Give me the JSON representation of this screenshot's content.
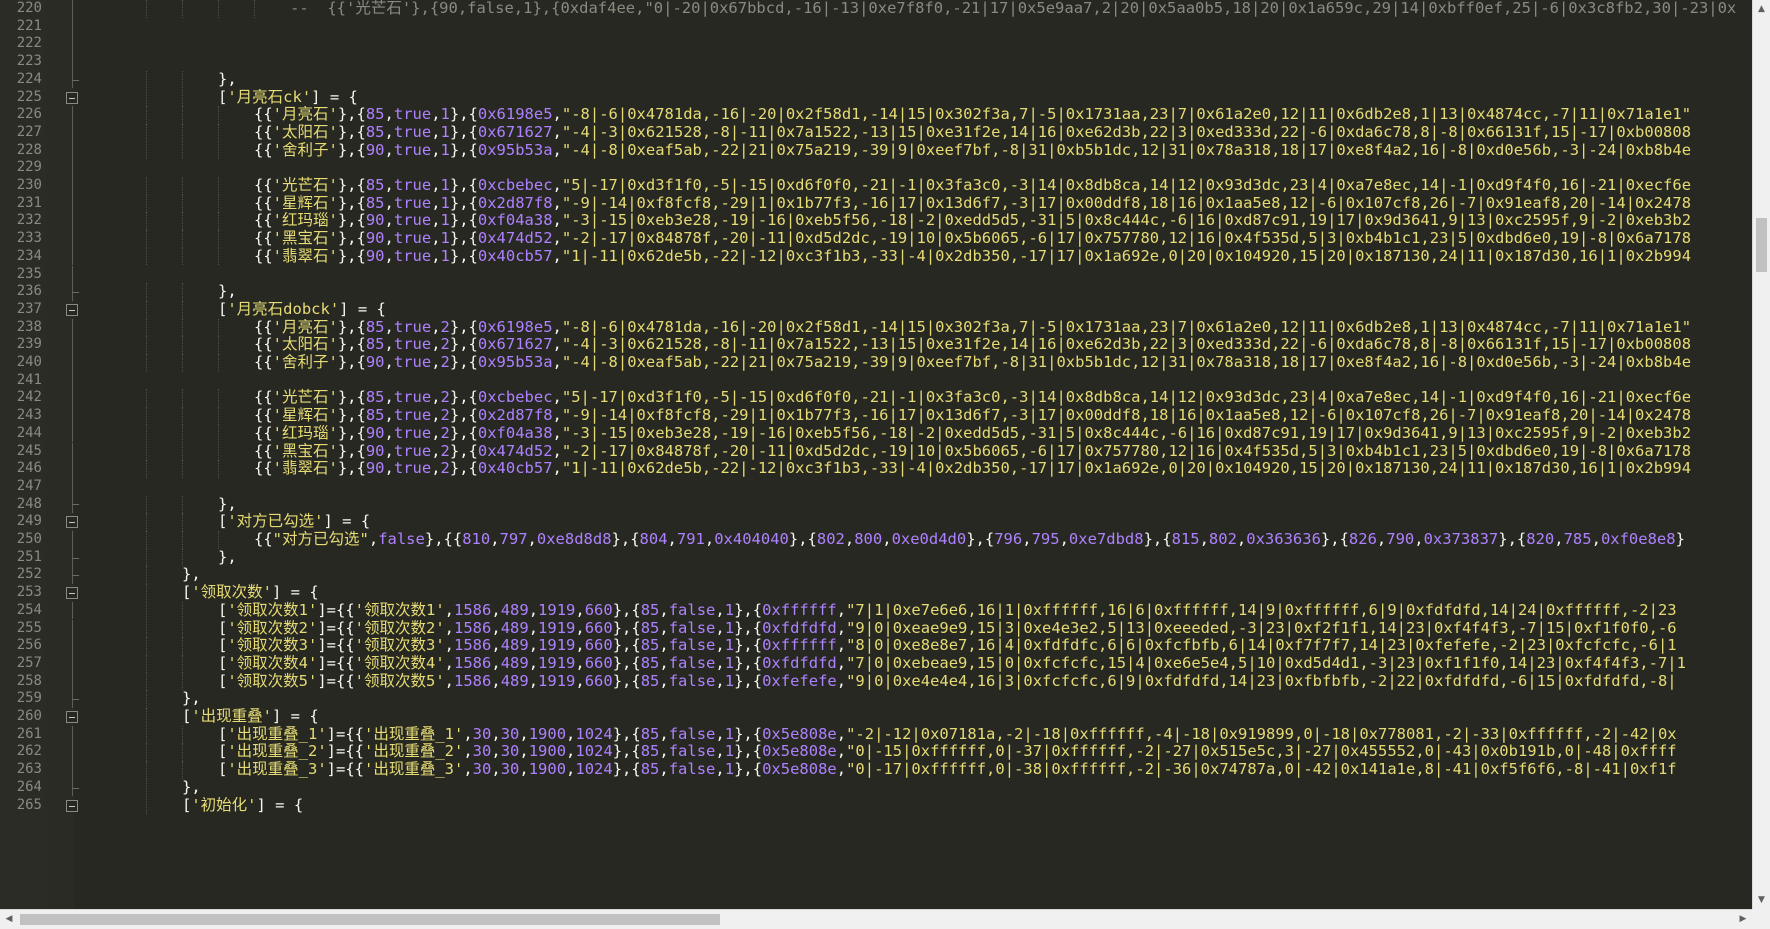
{
  "editor": {
    "lines": [
      {
        "num": "220",
        "indent": 5,
        "fold": "line",
        "text": "--  {{'光芒石'},{90,false,1},{0xdaf4ee,\"0|-20|0x67bbcd,-16|-13|0xe7f8f0,-21|17|0x5e9aa7,2|20|0x5aa0b5,18|20|0x1a659c,29|14|0xbff0ef,25|-6|0x3c8fb2,30|-23|0x"
      },
      {
        "num": "221",
        "indent": 0,
        "fold": "line",
        "text": ""
      },
      {
        "num": "222",
        "indent": 0,
        "fold": "line",
        "text": ""
      },
      {
        "num": "223",
        "indent": 0,
        "fold": "line",
        "text": ""
      },
      {
        "num": "224",
        "indent": 3,
        "fold": "end",
        "text": "},"
      },
      {
        "num": "225",
        "indent": 3,
        "fold": "box",
        "text": "['月亮石ck'] = {"
      },
      {
        "num": "226",
        "indent": 4,
        "fold": "line",
        "text": "{{'月亮石'},{85,true,1},{0x6198e5,\"-8|-6|0x4781da,-16|-20|0x2f58d1,-14|15|0x302f3a,7|-5|0x1731aa,23|7|0x61a2e0,12|11|0x6db2e8,1|13|0x4874cc,-7|11|0x71a1e1\""
      },
      {
        "num": "227",
        "indent": 4,
        "fold": "line",
        "text": "{{'太阳石'},{85,true,1},{0x671627,\"-4|-3|0x621528,-8|-11|0x7a1522,-13|15|0xe31f2e,14|16|0xe62d3b,22|3|0xed333d,22|-6|0xda6c78,8|-8|0x66131f,15|-17|0xb00808"
      },
      {
        "num": "228",
        "indent": 4,
        "fold": "line",
        "text": "{{'舍利子'},{90,true,1},{0x95b53a,\"-4|-8|0xeaf5ab,-22|21|0x75a219,-39|9|0xeef7bf,-8|31|0xb5b1dc,12|31|0x78a318,18|17|0xe8f4a2,16|-8|0xd0e56b,-3|-24|0xb8b4e"
      },
      {
        "num": "229",
        "indent": 0,
        "fold": "line",
        "text": ""
      },
      {
        "num": "230",
        "indent": 4,
        "fold": "line",
        "text": "{{'光芒石'},{85,true,1},{0xcbebec,\"5|-17|0xd3f1f0,-5|-15|0xd6f0f0,-21|-1|0x3fa3c0,-3|14|0x8db8ca,14|12|0x93d3dc,23|4|0xa7e8ec,14|-1|0xd9f4f0,16|-21|0xecf6e"
      },
      {
        "num": "231",
        "indent": 4,
        "fold": "line",
        "text": "{{'星辉石'},{85,true,1},{0x2d87f8,\"-9|-14|0xf8fcf8,-29|1|0x1b77f3,-16|17|0x13d6f7,-3|17|0x00ddf8,18|16|0x1aa5e8,12|-6|0x107cf8,26|-7|0x91eaf8,20|-14|0x2478"
      },
      {
        "num": "232",
        "indent": 4,
        "fold": "line",
        "text": "{{'红玛瑙'},{90,true,1},{0xf04a38,\"-3|-15|0xeb3e28,-19|-16|0xeb5f56,-18|-2|0xedd5d5,-31|5|0x8c444c,-6|16|0xd87c91,19|17|0x9d3641,9|13|0xc2595f,9|-2|0xeb3b2"
      },
      {
        "num": "233",
        "indent": 4,
        "fold": "line",
        "text": "{{'黑宝石'},{90,true,1},{0x474d52,\"-2|-17|0x84878f,-20|-11|0xd5d2dc,-19|10|0x5b6065,-6|17|0x757780,12|16|0x4f535d,5|3|0xb4b1c1,23|5|0xdbd6e0,19|-8|0x6a7178"
      },
      {
        "num": "234",
        "indent": 4,
        "fold": "line",
        "text": "{{'翡翠石'},{90,true,1},{0x40cb57,\"1|-11|0x62de5b,-22|-12|0xc3f1b3,-33|-4|0x2db350,-17|17|0x1a692e,0|20|0x104920,15|20|0x187130,24|11|0x187d30,16|1|0x2b994"
      },
      {
        "num": "235",
        "indent": 0,
        "fold": "line",
        "text": ""
      },
      {
        "num": "236",
        "indent": 3,
        "fold": "end",
        "text": "},"
      },
      {
        "num": "237",
        "indent": 3,
        "fold": "box",
        "text": "['月亮石dobck'] = {"
      },
      {
        "num": "238",
        "indent": 4,
        "fold": "line",
        "text": "{{'月亮石'},{85,true,2},{0x6198e5,\"-8|-6|0x4781da,-16|-20|0x2f58d1,-14|15|0x302f3a,7|-5|0x1731aa,23|7|0x61a2e0,12|11|0x6db2e8,1|13|0x4874cc,-7|11|0x71a1e1\""
      },
      {
        "num": "239",
        "indent": 4,
        "fold": "line",
        "text": "{{'太阳石'},{85,true,2},{0x671627,\"-4|-3|0x621528,-8|-11|0x7a1522,-13|15|0xe31f2e,14|16|0xe62d3b,22|3|0xed333d,22|-6|0xda6c78,8|-8|0x66131f,15|-17|0xb00808"
      },
      {
        "num": "240",
        "indent": 4,
        "fold": "line",
        "text": "{{'舍利子'},{90,true,2},{0x95b53a,\"-4|-8|0xeaf5ab,-22|21|0x75a219,-39|9|0xeef7bf,-8|31|0xb5b1dc,12|31|0x78a318,18|17|0xe8f4a2,16|-8|0xd0e56b,-3|-24|0xb8b4e"
      },
      {
        "num": "241",
        "indent": 0,
        "fold": "line",
        "text": ""
      },
      {
        "num": "242",
        "indent": 4,
        "fold": "line",
        "text": "{{'光芒石'},{85,true,2},{0xcbebec,\"5|-17|0xd3f1f0,-5|-15|0xd6f0f0,-21|-1|0x3fa3c0,-3|14|0x8db8ca,14|12|0x93d3dc,23|4|0xa7e8ec,14|-1|0xd9f4f0,16|-21|0xecf6e"
      },
      {
        "num": "243",
        "indent": 4,
        "fold": "line",
        "text": "{{'星辉石'},{85,true,2},{0x2d87f8,\"-9|-14|0xf8fcf8,-29|1|0x1b77f3,-16|17|0x13d6f7,-3|17|0x00ddf8,18|16|0x1aa5e8,12|-6|0x107cf8,26|-7|0x91eaf8,20|-14|0x2478"
      },
      {
        "num": "244",
        "indent": 4,
        "fold": "line",
        "text": "{{'红玛瑙'},{90,true,2},{0xf04a38,\"-3|-15|0xeb3e28,-19|-16|0xeb5f56,-18|-2|0xedd5d5,-31|5|0x8c444c,-6|16|0xd87c91,19|17|0x9d3641,9|13|0xc2595f,9|-2|0xeb3b2"
      },
      {
        "num": "245",
        "indent": 4,
        "fold": "line",
        "text": "{{'黑宝石'},{90,true,2},{0x474d52,\"-2|-17|0x84878f,-20|-11|0xd5d2dc,-19|10|0x5b6065,-6|17|0x757780,12|16|0x4f535d,5|3|0xb4b1c1,23|5|0xdbd6e0,19|-8|0x6a7178"
      },
      {
        "num": "246",
        "indent": 4,
        "fold": "line",
        "text": "{{'翡翠石'},{90,true,2},{0x40cb57,\"1|-11|0x62de5b,-22|-12|0xc3f1b3,-33|-4|0x2db350,-17|17|0x1a692e,0|20|0x104920,15|20|0x187130,24|11|0x187d30,16|1|0x2b994"
      },
      {
        "num": "247",
        "indent": 0,
        "fold": "line",
        "text": ""
      },
      {
        "num": "248",
        "indent": 3,
        "fold": "end",
        "text": "},"
      },
      {
        "num": "249",
        "indent": 3,
        "fold": "box",
        "text": "['对方已勾选'] = {"
      },
      {
        "num": "250",
        "indent": 4,
        "fold": "line",
        "text": "{{\"对方已勾选\",false},{{810,797,0xe8d8d8},{804,791,0x404040},{802,800,0xe0d4d0},{796,795,0xe7dbd8},{815,802,0x363636},{826,790,0x373837},{820,785,0xf0e8e8}"
      },
      {
        "num": "251",
        "indent": 3,
        "fold": "end",
        "text": "},"
      },
      {
        "num": "252",
        "indent": 2,
        "fold": "end",
        "text": "},"
      },
      {
        "num": "253",
        "indent": 2,
        "fold": "box",
        "text": "['领取次数'] = {"
      },
      {
        "num": "254",
        "indent": 3,
        "fold": "line",
        "text": "['领取次数1']={{'领取次数1',1586,489,1919,660},{85,false,1},{0xffffff,\"7|1|0xe7e6e6,16|1|0xffffff,16|6|0xffffff,14|9|0xffffff,6|9|0xfdfdfd,14|24|0xffffff,-2|23"
      },
      {
        "num": "255",
        "indent": 3,
        "fold": "line",
        "text": "['领取次数2']={{'领取次数2',1586,489,1919,660},{85,false,1},{0xfdfdfd,\"9|0|0xeae9e9,15|3|0xe4e3e2,5|13|0xeeeded,-3|23|0xf2f1f1,14|23|0xf4f4f3,-7|15|0xf1f0f0,-6"
      },
      {
        "num": "256",
        "indent": 3,
        "fold": "line",
        "text": "['领取次数3']={{'领取次数3',1586,489,1919,660},{85,false,1},{0xffffff,\"8|0|0xe8e8e7,16|4|0xfdfdfc,6|6|0xfcfbfb,6|14|0xf7f7f7,14|23|0xfefefe,-2|23|0xfcfcfc,-6|1"
      },
      {
        "num": "257",
        "indent": 3,
        "fold": "line",
        "text": "['领取次数4']={{'领取次数4',1586,489,1919,660},{85,false,1},{0xfdfdfd,\"7|0|0xebeae9,15|0|0xfcfcfc,15|4|0xe6e5e4,5|10|0xd5d4d1,-3|23|0xf1f1f0,14|23|0xf4f4f3,-7|1"
      },
      {
        "num": "258",
        "indent": 3,
        "fold": "line",
        "text": "['领取次数5']={{'领取次数5',1586,489,1919,660},{85,false,1},{0xfefefe,\"9|0|0xe4e4e4,16|3|0xfcfcfc,6|9|0xfdfdfd,14|23|0xfbfbfb,-2|22|0xfdfdfd,-6|15|0xfdfdfd,-8|"
      },
      {
        "num": "259",
        "indent": 2,
        "fold": "end",
        "text": "},"
      },
      {
        "num": "260",
        "indent": 2,
        "fold": "box",
        "text": "['出现重叠'] = {"
      },
      {
        "num": "261",
        "indent": 3,
        "fold": "line",
        "text": "['出现重叠_1']={{'出现重叠_1',30,30,1900,1024},{85,false,1},{0x5e808e,\"-2|-12|0x07181a,-2|-18|0xffffff,-4|-18|0x919899,0|-18|0x778081,-2|-33|0xffffff,-2|-42|0x"
      },
      {
        "num": "262",
        "indent": 3,
        "fold": "line",
        "text": "['出现重叠_2']={{'出现重叠_2',30,30,1900,1024},{85,false,1},{0x5e808e,\"0|-15|0xffffff,0|-37|0xffffff,-2|-27|0x515e5c,3|-27|0x455552,0|-43|0x0b191b,0|-48|0xffff"
      },
      {
        "num": "263",
        "indent": 3,
        "fold": "line",
        "text": "['出现重叠_3']={{'出现重叠_3',30,30,1900,1024},{85,false,1},{0x5e808e,\"0|-17|0xffffff,0|-38|0xffffff,-2|-36|0x74787a,0|-42|0x141a1e,8|-41|0xf5f6f6,-8|-41|0xf1f"
      },
      {
        "num": "264",
        "indent": 2,
        "fold": "end",
        "text": "},"
      },
      {
        "num": "265",
        "indent": 2,
        "fold": "box",
        "text": "['初始化'] = {"
      }
    ]
  },
  "scrollbars": {
    "vertical_up": "▲",
    "vertical_down": "▼",
    "horizontal_left": "◀",
    "horizontal_right": "▶"
  },
  "colors": {
    "background": "#272822",
    "string": "#e6db74",
    "number": "#ae81ff",
    "punctuation": "#f8f8f2",
    "comment": "#8a8a7f",
    "line_number": "#8a8a7f"
  }
}
